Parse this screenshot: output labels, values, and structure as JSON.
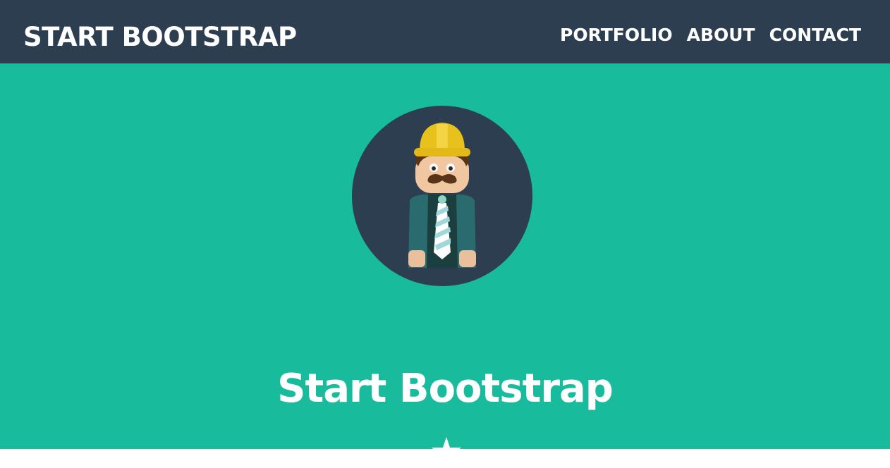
{
  "navbar": {
    "brand": "START BOOTSTRAP",
    "links": [
      "PORTFOLIO",
      "ABOUT",
      "CONTACT"
    ]
  },
  "header": {
    "title": "Start Bootstrap",
    "avatar_icon": "construction-worker-avatar-icon",
    "divider_icon": "star-icon"
  },
  "colors": {
    "navbar_bg": "#2c3e50",
    "header_bg": "#18bc9c",
    "text": "#ffffff",
    "helmet": "#e8c21c",
    "tie": "#a8dadc"
  }
}
